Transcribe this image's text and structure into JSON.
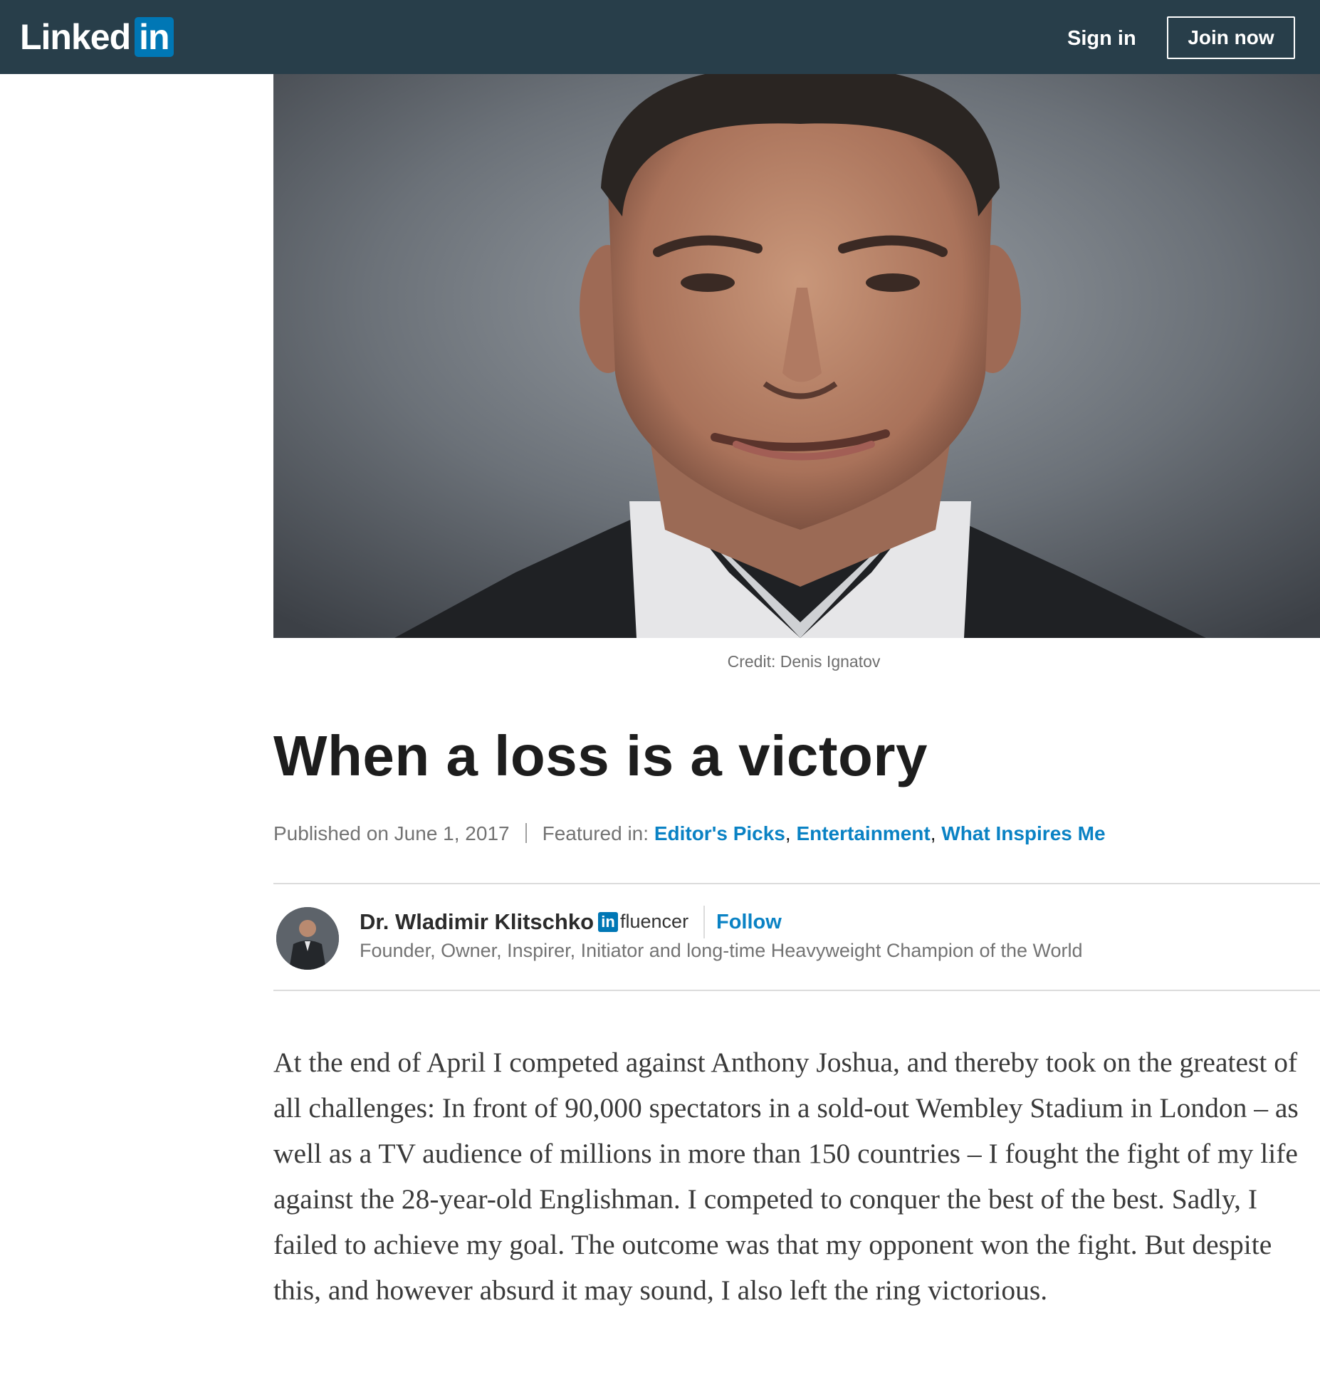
{
  "header": {
    "logo_text": "Linked",
    "logo_badge": "in",
    "sign_in_label": "Sign in",
    "join_label": "Join now"
  },
  "hero": {
    "credit": "Credit: Denis Ignatov"
  },
  "article": {
    "title": "When a loss is a victory",
    "published": "Published on June 1, 2017",
    "featured_label": "Featured in:",
    "featured": [
      "Editor's Picks",
      "Entertainment",
      "What Inspires Me"
    ],
    "author": {
      "name": "Dr. Wladimir Klitschko",
      "badge_in": "in",
      "badge_text": "fluencer",
      "follow_label": "Follow",
      "headline": "Founder, Owner, Inspirer, Initiator and long-time Heavyweight Champion of the World"
    },
    "body": "At the end of April I competed against Anthony Joshua, and thereby took on the greatest of all challenges: In front of 90,000 spectators in a sold-out Wembley Stadium in London – as well as a TV audience of millions in more than 150 countries – I fought the fight of my life against the 28-year-old Englishman. I competed to conquer the best of the best. Sadly, I failed to achieve my goal. The outcome was that my opponent won the fight. But despite this, and however absurd it may sound, I also left the ring victorious."
  },
  "colors": {
    "header_bg": "#283e4a",
    "brand_blue": "#0077b5",
    "link_blue": "#0a82c4"
  }
}
